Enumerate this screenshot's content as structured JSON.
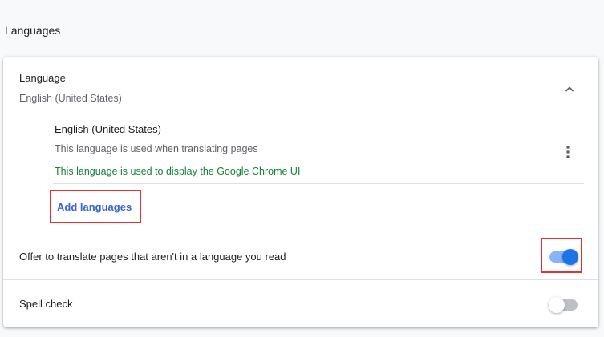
{
  "section_title": "Languages",
  "language": {
    "title": "Language",
    "current": "English (United States)",
    "expanded": true,
    "chevron_icon": "chevron-up-icon",
    "items": [
      {
        "name": "English (United States)",
        "translate_note": "This language is used when translating pages",
        "ui_note": "This language is used to display the Google Chrome UI",
        "menu_icon": "more-vert-icon"
      }
    ],
    "add_label": "Add languages"
  },
  "translate": {
    "label": "Offer to translate pages that aren't in a language you read",
    "enabled": true
  },
  "spell_check": {
    "label": "Spell check",
    "enabled": false
  },
  "colors": {
    "accent": "#1a73e8",
    "success_text": "#188038",
    "link": "#3b66d0",
    "highlight": "#e5312d"
  }
}
